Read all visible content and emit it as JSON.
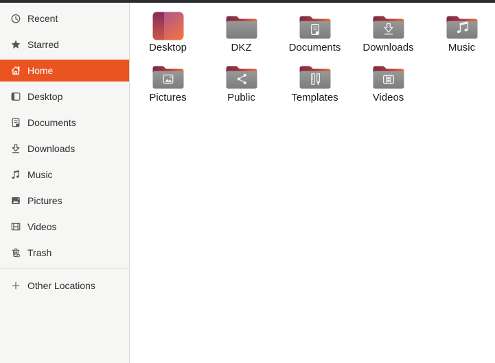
{
  "theme": {
    "accent": "#e95420",
    "topbar_color": "#2b2b2d",
    "sidebar_bg": "#f6f6f5",
    "content_bg": "#ffffff",
    "folder_body_gray": "#8c8c8c",
    "folder_tab_left": "#7c2b45",
    "folder_tab_right": "#ec6b33"
  },
  "sidebar": {
    "items": [
      {
        "id": "recent",
        "label": "Recent",
        "icon": "recent-clock-icon",
        "selected": false
      },
      {
        "id": "starred",
        "label": "Starred",
        "icon": "star-icon",
        "selected": false
      },
      {
        "id": "home",
        "label": "Home",
        "icon": "home-icon",
        "selected": true
      },
      {
        "id": "desktop",
        "label": "Desktop",
        "icon": "desktop-icon",
        "selected": false
      },
      {
        "id": "documents",
        "label": "Documents",
        "icon": "documents-icon",
        "selected": false
      },
      {
        "id": "downloads",
        "label": "Downloads",
        "icon": "download-arrow-icon",
        "selected": false
      },
      {
        "id": "music",
        "label": "Music",
        "icon": "music-note-icon",
        "selected": false
      },
      {
        "id": "pictures",
        "label": "Pictures",
        "icon": "picture-icon",
        "selected": false
      },
      {
        "id": "videos",
        "label": "Videos",
        "icon": "film-strip-icon",
        "selected": false
      },
      {
        "id": "trash",
        "label": "Trash",
        "icon": "trash-icon",
        "selected": false
      },
      {
        "type": "separator"
      },
      {
        "id": "other-locations",
        "label": "Other Locations",
        "icon": "plus-icon",
        "selected": false
      }
    ]
  },
  "files": {
    "items": [
      {
        "label": "Desktop",
        "icon": "desktop-gradient-folder-icon",
        "kind": "desktop"
      },
      {
        "label": "DKZ",
        "icon": "folder-icon",
        "kind": "plain"
      },
      {
        "label": "Documents",
        "icon": "folder-documents-icon",
        "kind": "document"
      },
      {
        "label": "Downloads",
        "icon": "folder-downloads-icon",
        "kind": "download"
      },
      {
        "label": "Music",
        "icon": "folder-music-icon",
        "kind": "music"
      },
      {
        "label": "Pictures",
        "icon": "folder-pictures-icon",
        "kind": "picture"
      },
      {
        "label": "Public",
        "icon": "folder-share-icon",
        "kind": "share"
      },
      {
        "label": "Templates",
        "icon": "folder-templates-icon",
        "kind": "template"
      },
      {
        "label": "Videos",
        "icon": "folder-videos-icon",
        "kind": "video"
      }
    ]
  }
}
